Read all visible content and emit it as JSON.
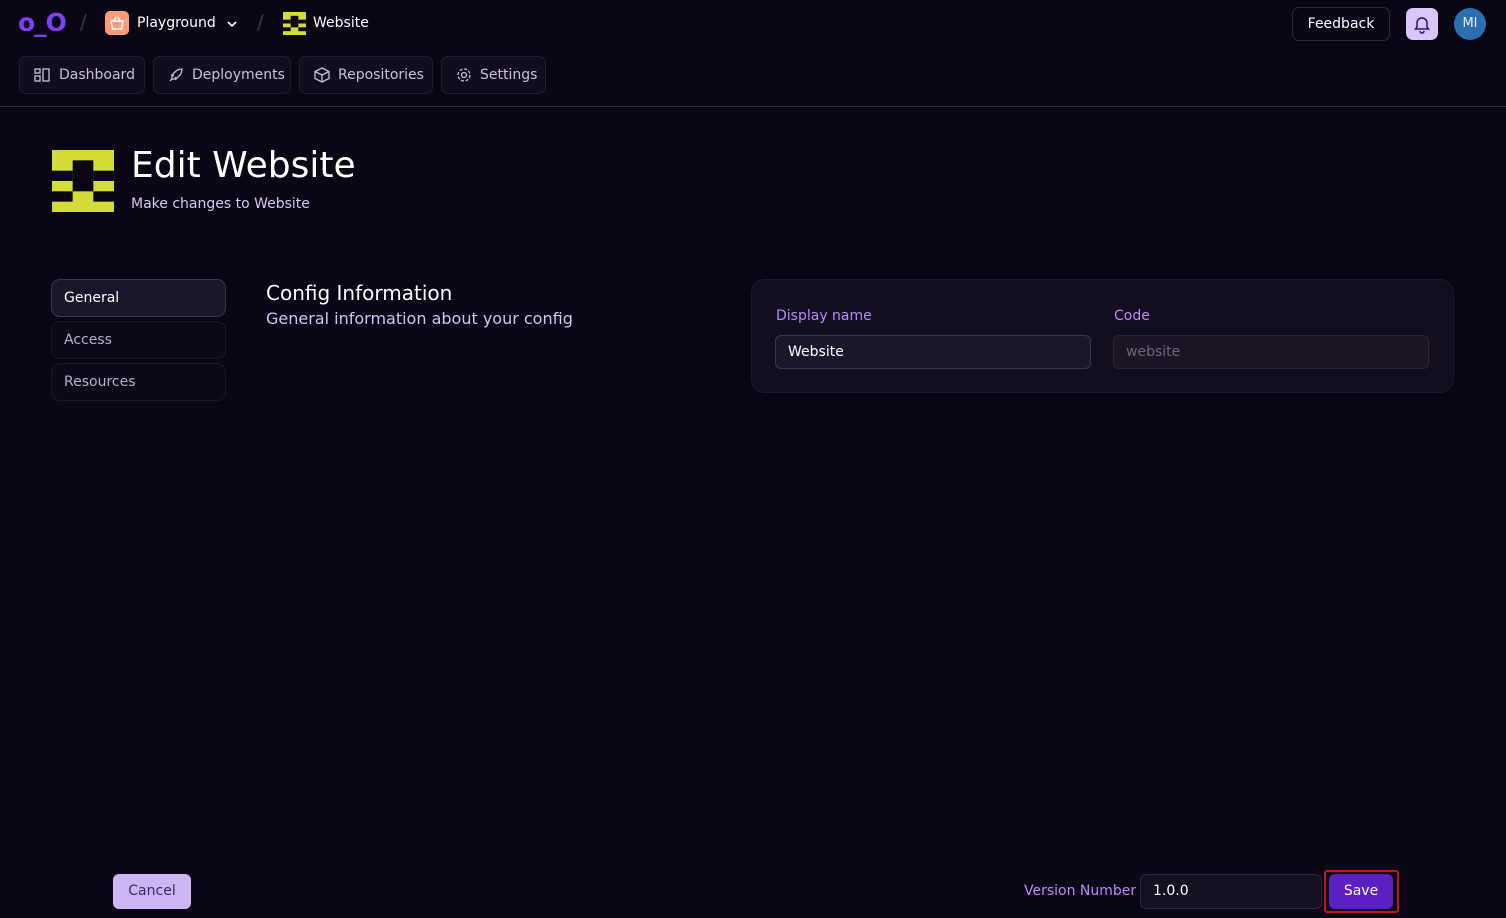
{
  "topbar": {
    "logo": "o_O",
    "org_name": "Playground",
    "project_name": "Website",
    "feedback_label": "Feedback",
    "avatar_initials": "MI"
  },
  "nav": {
    "tabs": [
      {
        "label": "Dashboard",
        "icon": "dashboard-icon"
      },
      {
        "label": "Deployments",
        "icon": "rocket-icon"
      },
      {
        "label": "Repositories",
        "icon": "package-icon"
      },
      {
        "label": "Settings",
        "icon": "gear-icon"
      }
    ]
  },
  "header": {
    "title": "Edit Website",
    "subtitle": "Make changes to Website"
  },
  "side_menu": {
    "items": [
      {
        "label": "General",
        "active": true
      },
      {
        "label": "Access",
        "active": false
      },
      {
        "label": "Resources",
        "active": false
      }
    ]
  },
  "section": {
    "title": "Config Information",
    "subtitle": "General information about your config"
  },
  "form": {
    "display_name_label": "Display name",
    "display_name_value": "Website",
    "code_label": "Code",
    "code_value": "website"
  },
  "footer": {
    "cancel_label": "Cancel",
    "version_label": "Version Number",
    "version_value": "1.0.0",
    "save_label": "Save"
  },
  "colors": {
    "background": "#0b0615",
    "accent_purple": "#5b1fc2",
    "logo_purple": "#7f3ff2",
    "label_purple": "#b48df7",
    "project_icon_lime": "#d4dc3a",
    "highlight_red": "#c4141e"
  }
}
